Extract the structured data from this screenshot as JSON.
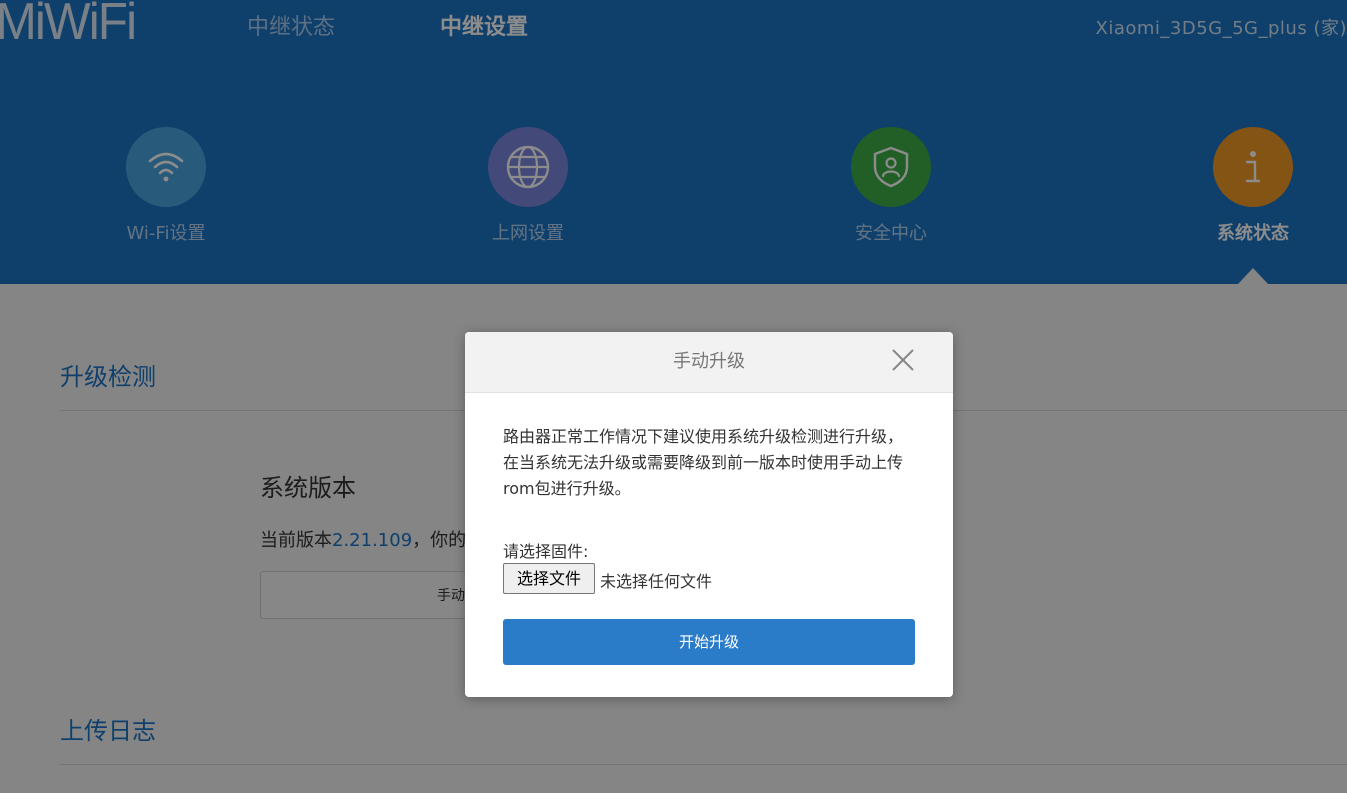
{
  "header": {
    "logo_text": "MiWiFi",
    "tabs": [
      {
        "label": "中继状态",
        "active": false
      },
      {
        "label": "中继设置",
        "active": true
      }
    ],
    "device_name": "Xiaomi_3D5G_5G_plus (家)"
  },
  "nav": {
    "items": [
      {
        "label": "Wi-Fi设置",
        "icon": "wifi-icon",
        "color": "#4aa6e0"
      },
      {
        "label": "上网设置",
        "icon": "globe-icon",
        "color": "#7b86dc"
      },
      {
        "label": "安全中心",
        "icon": "shield-user-icon",
        "color": "#3fae47"
      },
      {
        "label": "系统状态",
        "icon": "info-icon",
        "color": "#f19a25",
        "active": true
      }
    ]
  },
  "content": {
    "upgrade_section_title": "升级检测",
    "system_version_title": "系统版本",
    "current_version_prefix": "当前版本",
    "current_version": "2.21.109",
    "current_version_suffix": "，你的",
    "manual_upgrade_button": "手动",
    "log_section_title": "上传日志"
  },
  "modal": {
    "title": "手动升级",
    "description": "路由器正常工作情况下建议使用系统升级检测进行升级，在当系统无法升级或需要降级到前一版本时使用手动上传rom包进行升级。",
    "choose_label": "请选择固件:",
    "file_button": "选择文件",
    "file_status": "未选择任何文件",
    "start_button": "开始升级"
  },
  "colors": {
    "header_blue": "#1c74c4",
    "accent_blue": "#2a7bc8"
  }
}
